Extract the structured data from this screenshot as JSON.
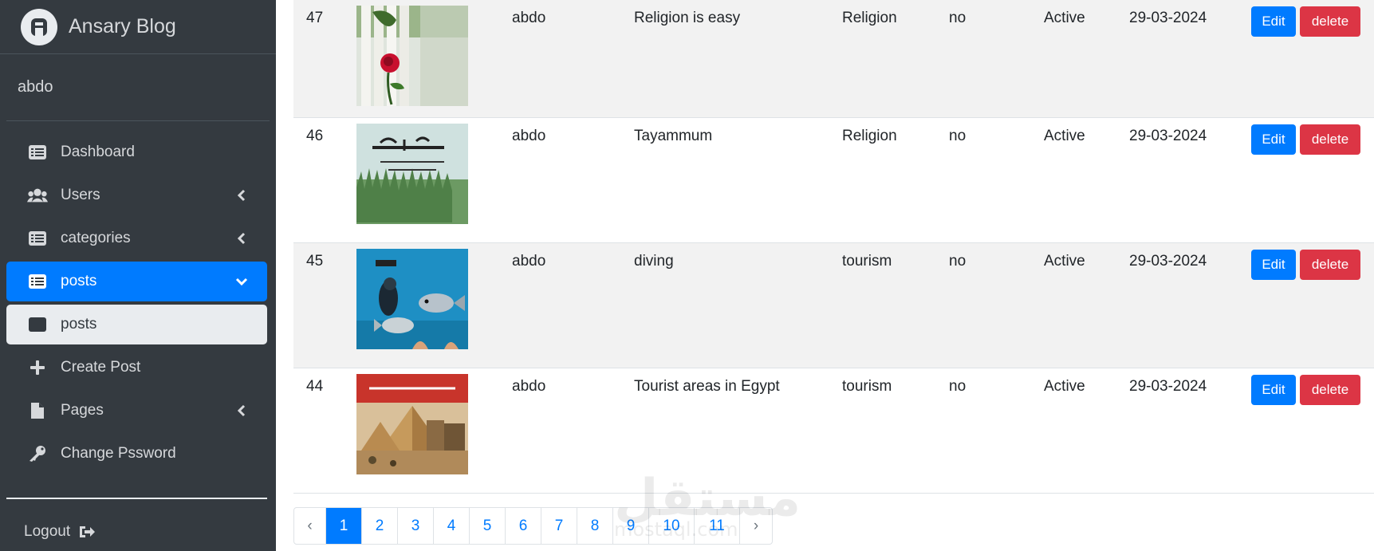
{
  "brand": {
    "name": "Ansary Blog"
  },
  "user": {
    "name": "abdo"
  },
  "nav": [
    {
      "label": "Dashboard",
      "icon": "list-icon",
      "state": "normal",
      "chevron": false
    },
    {
      "label": "Users",
      "icon": "users-icon",
      "state": "normal",
      "chevron": "left"
    },
    {
      "label": "categories",
      "icon": "list-icon",
      "state": "normal",
      "chevron": "left"
    },
    {
      "label": "posts",
      "icon": "list-icon",
      "state": "active",
      "chevron": "down"
    },
    {
      "label": "posts",
      "icon": "list-icon",
      "state": "sub-active",
      "chevron": false
    },
    {
      "label": "Create Post",
      "icon": "plus-icon",
      "state": "normal",
      "chevron": false
    },
    {
      "label": "Pages",
      "icon": "file-icon",
      "state": "normal",
      "chevron": "left"
    },
    {
      "label": "Change Pssword",
      "icon": "key-icon",
      "state": "normal",
      "chevron": false
    }
  ],
  "logout": {
    "label": "Logout"
  },
  "table": {
    "rows": [
      {
        "id": "47",
        "image": "rose-fence-thumbnail",
        "author": "abdo",
        "title": "Religion is easy",
        "category": "Religion",
        "favorite": "no",
        "status": "Active",
        "date": "29-03-2024",
        "edit": "Edit",
        "delete": "delete"
      },
      {
        "id": "46",
        "image": "arabic-calligraphy-grass-thumbnail",
        "author": "abdo",
        "title": "Tayammum",
        "category": "Religion",
        "favorite": "no",
        "status": "Active",
        "date": "29-03-2024",
        "edit": "Edit",
        "delete": "delete"
      },
      {
        "id": "45",
        "image": "diver-fish-thumbnail",
        "author": "abdo",
        "title": "diving",
        "category": "tourism",
        "favorite": "no",
        "status": "Active",
        "date": "29-03-2024",
        "edit": "Edit",
        "delete": "delete"
      },
      {
        "id": "44",
        "image": "egypt-pyramids-thumbnail",
        "author": "abdo",
        "title": "Tourist areas in Egypt",
        "category": "tourism",
        "favorite": "no",
        "status": "Active",
        "date": "29-03-2024",
        "edit": "Edit",
        "delete": "delete"
      }
    ]
  },
  "pagination": {
    "prev": "‹",
    "pages": [
      "1",
      "2",
      "3",
      "4",
      "5",
      "6",
      "7",
      "8",
      "9",
      "10",
      "11"
    ],
    "current": "1",
    "next": "›"
  },
  "watermark": {
    "text": "مستقل",
    "sub": "mostaql.com"
  },
  "colors": {
    "sidebar": "#343a40",
    "primary": "#007bff",
    "danger": "#dc3545",
    "stripe": "#f2f2f2"
  }
}
